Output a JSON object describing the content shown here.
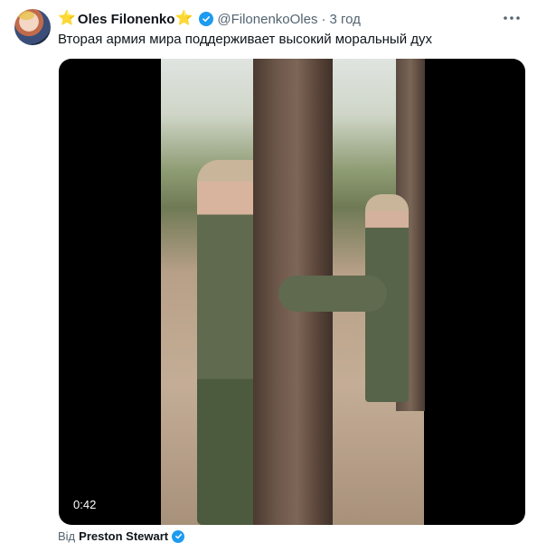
{
  "author": {
    "prefix_emoji": "⭐",
    "name": "Oles Filonenko",
    "suffix_emoji": "⭐",
    "handle": "@FilonenkoOles",
    "separator": "·",
    "time": "3 год"
  },
  "tweet": {
    "text": "Вторая армия мира поддерживает высокий моральный дух"
  },
  "media": {
    "duration": "0:42"
  },
  "attribution": {
    "prefix": "Від",
    "source": "Preston Stewart"
  },
  "icons": {
    "verified": "verified-badge-icon",
    "more": "more-options-icon"
  },
  "colors": {
    "verified": "#1d9bf0",
    "star": "#f4b400",
    "secondary_text": "#536471"
  }
}
